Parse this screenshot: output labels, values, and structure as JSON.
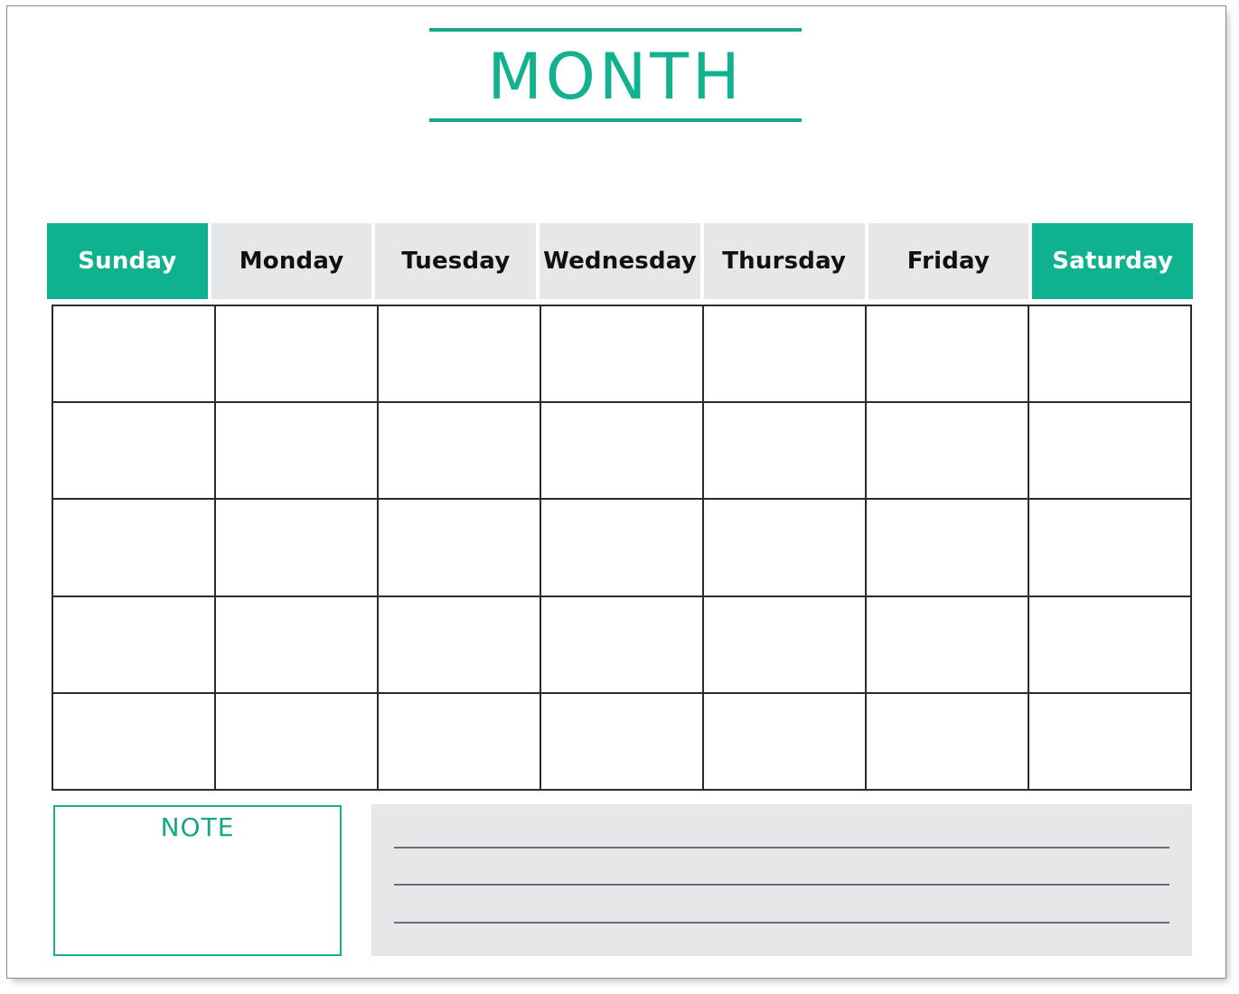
{
  "page": {
    "title": "MONTH",
    "accent_color": "#0fb28e",
    "accent_rule_color": "#18a98a",
    "header_gray": "#e6e7e9",
    "grid_border_color": "#2b2b2b",
    "note_border_color": "#18b08d",
    "note_line_color": "#6b6e72"
  },
  "weekdays": [
    {
      "label": "Sunday",
      "highlighted": true
    },
    {
      "label": "Monday",
      "highlighted": false
    },
    {
      "label": "Tuesday",
      "highlighted": false
    },
    {
      "label": "Wednesday",
      "highlighted": false
    },
    {
      "label": "Thursday",
      "highlighted": false
    },
    {
      "label": "Friday",
      "highlighted": false
    },
    {
      "label": "Saturday",
      "highlighted": true
    }
  ],
  "grid": {
    "rows": 5,
    "columns": 7,
    "cells": [
      "",
      "",
      "",
      "",
      "",
      "",
      "",
      "",
      "",
      "",
      "",
      "",
      "",
      "",
      "",
      "",
      "",
      "",
      "",
      "",
      "",
      "",
      "",
      "",
      "",
      "",
      "",
      "",
      "",
      "",
      "",
      "",
      "",
      "",
      ""
    ]
  },
  "note": {
    "label": "NOTE",
    "content": ""
  },
  "lined_panel": {
    "line_count": 3,
    "lines": [
      "",
      "",
      ""
    ]
  }
}
